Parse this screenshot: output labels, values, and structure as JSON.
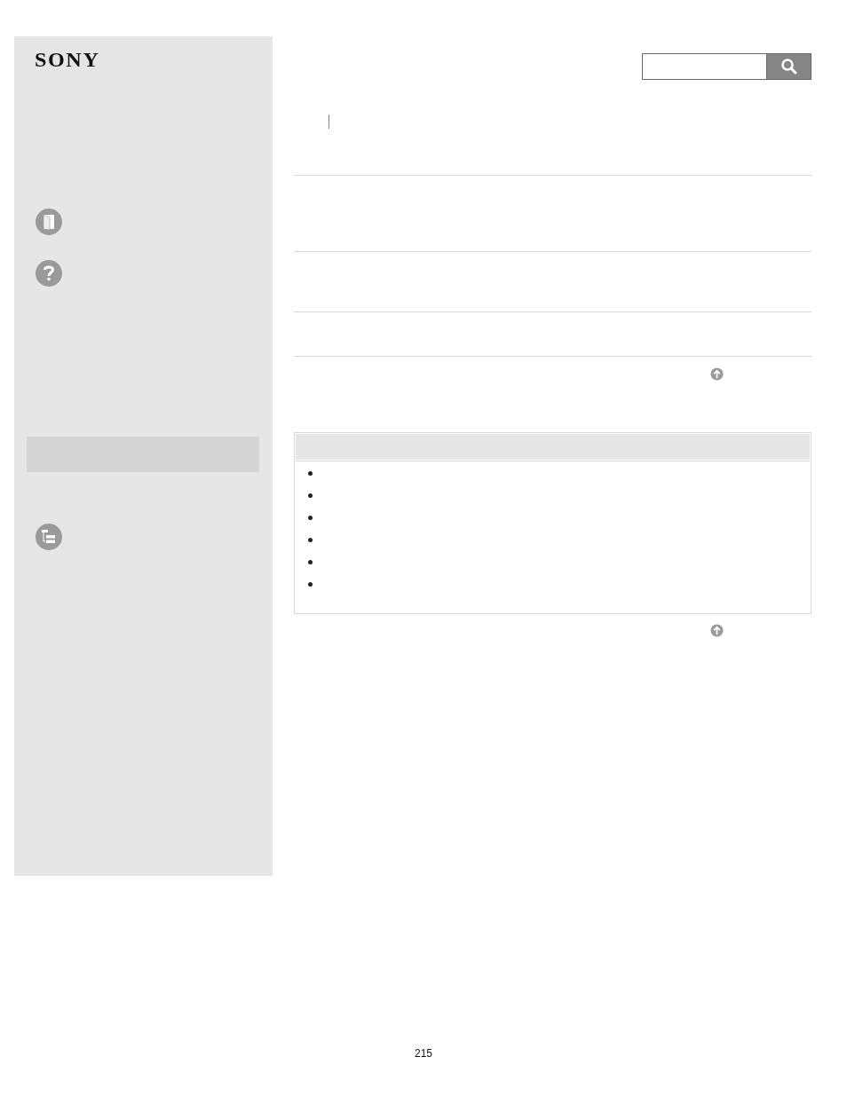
{
  "logo": {
    "text": "SONY"
  },
  "notes_box": {
    "items": [
      {
        "kind": "bullet"
      },
      {
        "kind": "bullet"
      },
      {
        "kind": "bullet"
      },
      {
        "kind": "bullet"
      },
      {
        "kind": "bullet"
      },
      {
        "kind": "bullet"
      }
    ]
  },
  "page_number": "215"
}
